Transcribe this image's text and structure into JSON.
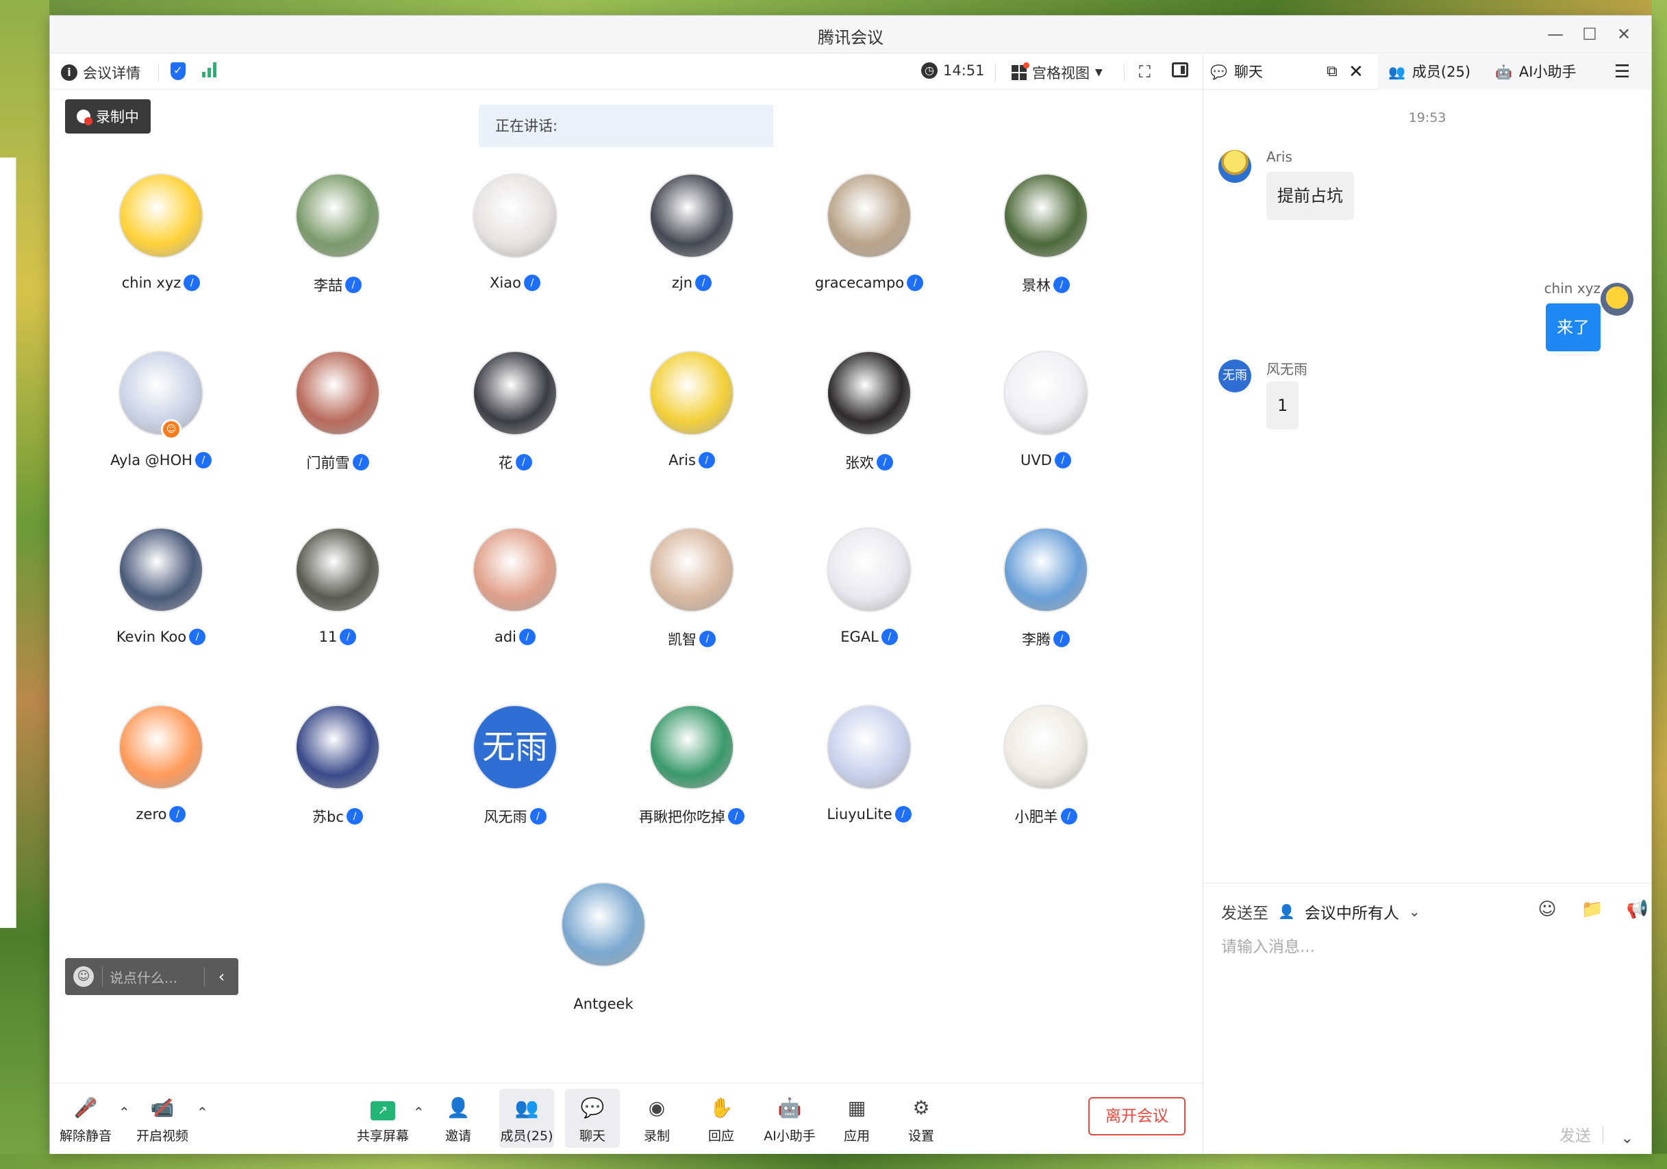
{
  "window": {
    "title": "腾讯会议"
  },
  "toolbar": {
    "details_label": "会议详情",
    "time": "14:51",
    "view_label": "宫格视图"
  },
  "stage": {
    "recording_badge": "录制中",
    "speaking_label": "正在讲话:",
    "chat_placeholder": "说点什么..."
  },
  "participants": [
    {
      "name": "chin xyz",
      "avatar_color": "#ffd23a"
    },
    {
      "name": "李喆",
      "avatar_color": "#7a9a6a"
    },
    {
      "name": "Xiao",
      "avatar_color": "#e7e2df"
    },
    {
      "name": "zjn",
      "avatar_color": "#444a55"
    },
    {
      "name": "gracecampo",
      "avatar_color": "#b9a48a"
    },
    {
      "name": "景林",
      "avatar_color": "#4d6a3a"
    },
    {
      "name": "Ayla @HOH",
      "avatar_color": "#c9d3e6"
    },
    {
      "name": "门前雪",
      "avatar_color": "#b86a5a"
    },
    {
      "name": "花",
      "avatar_color": "#3a3d45"
    },
    {
      "name": "Aris",
      "avatar_color": "#f3d03a"
    },
    {
      "name": "张欢",
      "avatar_color": "#2e2a2a"
    },
    {
      "name": "UVD",
      "avatar_color": "#eeeef5"
    },
    {
      "name": "Kevin Koo",
      "avatar_color": "#4a5a7a"
    },
    {
      "name": "11",
      "avatar_color": "#5a5a50"
    },
    {
      "name": "adi",
      "avatar_color": "#e0a08a"
    },
    {
      "name": "凯智",
      "avatar_color": "#d8b8a0"
    },
    {
      "name": "EGAL",
      "avatar_color": "#e8e8f0"
    },
    {
      "name": "李腾",
      "avatar_color": "#6aa0d8"
    },
    {
      "name": "zero",
      "avatar_color": "#ff9a5a"
    },
    {
      "name": "苏bc",
      "avatar_color": "#3a4a8a"
    },
    {
      "name": "风无雨",
      "avatar_color": "#2f6fd4",
      "avatar_text": "无雨"
    },
    {
      "name": "再瞅把你吃掉",
      "avatar_color": "#3a9a6a"
    },
    {
      "name": "LiuyuLite",
      "avatar_color": "#c8d2ec"
    },
    {
      "name": "小肥羊",
      "avatar_color": "#f0ebe2"
    },
    {
      "name": "Antgeek",
      "avatar_color": "#7aa8d0"
    }
  ],
  "bottombar": {
    "unmute": "解除静音",
    "start_video": "开启视频",
    "share_screen": "共享屏幕",
    "invite": "邀请",
    "members": "成员(25)",
    "chat": "聊天",
    "record": "录制",
    "react": "回应",
    "ai_assistant": "AI小助手",
    "apps": "应用",
    "settings": "设置",
    "leave": "离开会议"
  },
  "panel": {
    "tab_chat": "聊天",
    "tab_members": "成员(25)",
    "tab_ai": "AI小助手",
    "time": "19:53",
    "messages": [
      {
        "sender": "Aris",
        "text": "提前占坑",
        "mine": false
      },
      {
        "sender": "chin xyz",
        "text": "来了",
        "mine": true
      },
      {
        "sender": "风无雨",
        "text": "1",
        "mine": false,
        "avatar_text": "无雨"
      }
    ],
    "send_to_label": "发送至",
    "send_to_target": "会议中所有人",
    "input_placeholder": "请输入消息...",
    "send_label": "发送"
  }
}
